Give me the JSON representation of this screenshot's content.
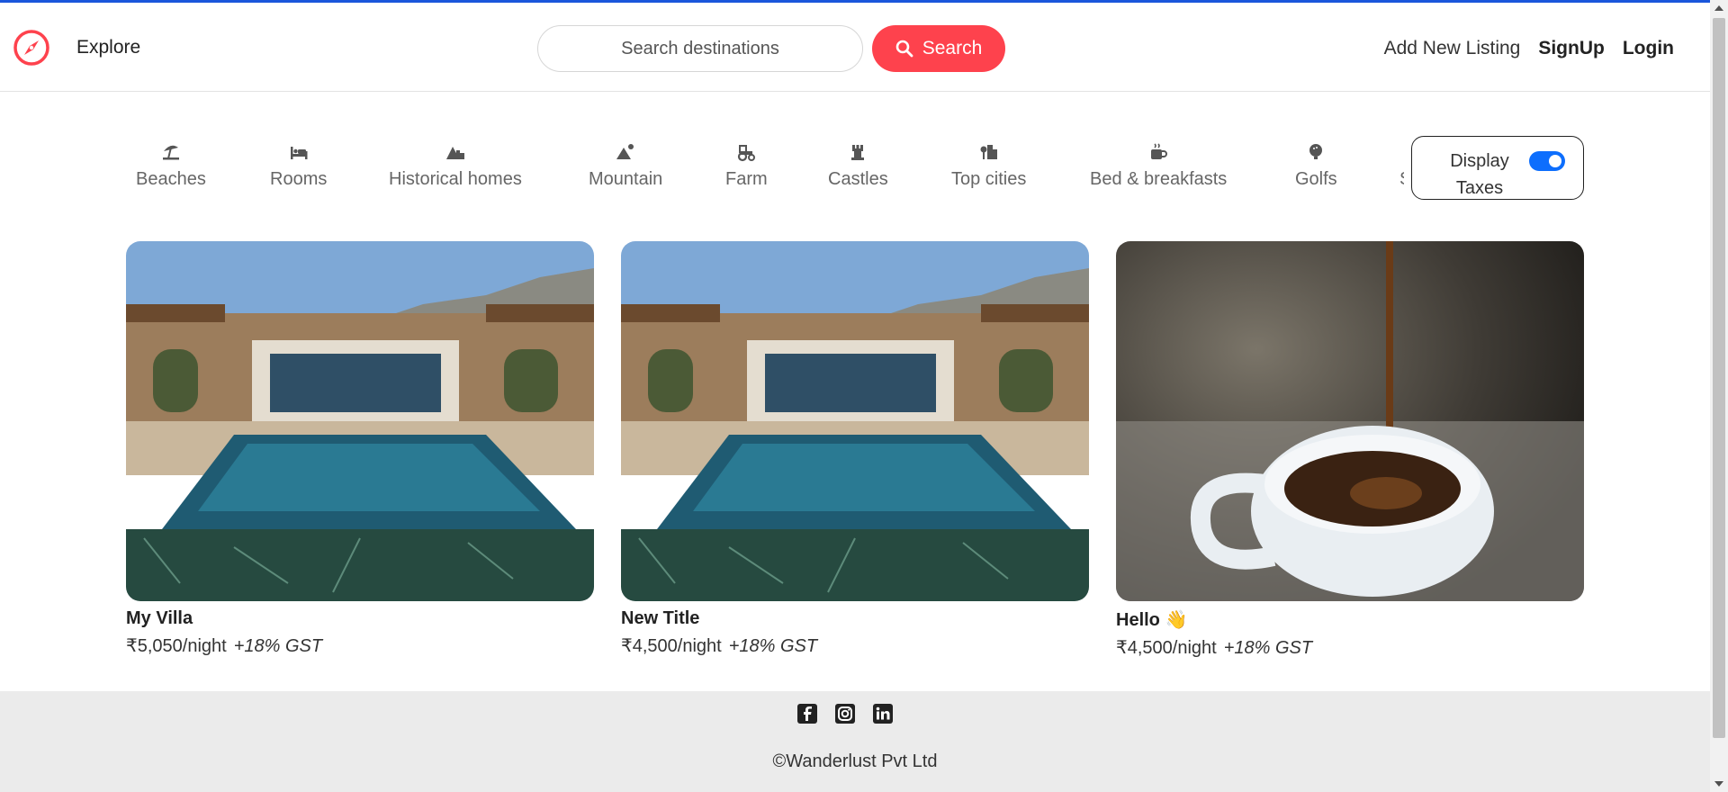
{
  "navbar": {
    "logo_icon": "compass-icon",
    "explore_label": "Explore",
    "search_placeholder": "Search destinations",
    "search_button": "Search",
    "add_listing": "Add New Listing",
    "signup": "SignUp",
    "login": "Login"
  },
  "filters": [
    {
      "label": "Beaches",
      "icon": "umbrella-beach-icon"
    },
    {
      "label": "Rooms",
      "icon": "bed-icon"
    },
    {
      "label": "Historical homes",
      "icon": "mountain-city-icon"
    },
    {
      "label": "Mountain",
      "icon": "mountain-sun-icon"
    },
    {
      "label": "Farm",
      "icon": "tractor-icon"
    },
    {
      "label": "Castles",
      "icon": "chess-rook-icon"
    },
    {
      "label": "Top cities",
      "icon": "city-icon"
    },
    {
      "label": "Bed & breakfasts",
      "icon": "mug-hot-icon"
    },
    {
      "label": "Golfs",
      "icon": "golf-ball-icon"
    },
    {
      "label": "S",
      "icon": "partial-icon"
    }
  ],
  "tax_toggle": {
    "label": "Display Taxes",
    "checked": true
  },
  "listings": [
    {
      "title": "My Villa",
      "price": "₹5,050/night",
      "tax": "+18% GST",
      "image": "villa-pool"
    },
    {
      "title": "New Title",
      "price": "₹4,500/night",
      "tax": "+18% GST",
      "image": "villa-pool"
    },
    {
      "title": "Hello 👋",
      "price": "₹4,500/night",
      "tax": "+18% GST",
      "image": "coffee-cup"
    }
  ],
  "footer": {
    "socials": [
      "facebook-icon",
      "instagram-icon",
      "linkedin-icon"
    ],
    "copyright": "©Wanderlust Pvt Ltd"
  },
  "colors": {
    "brand": "#fe424d",
    "toggle": "#0d6efd",
    "footer_bg": "#ebebeb"
  }
}
